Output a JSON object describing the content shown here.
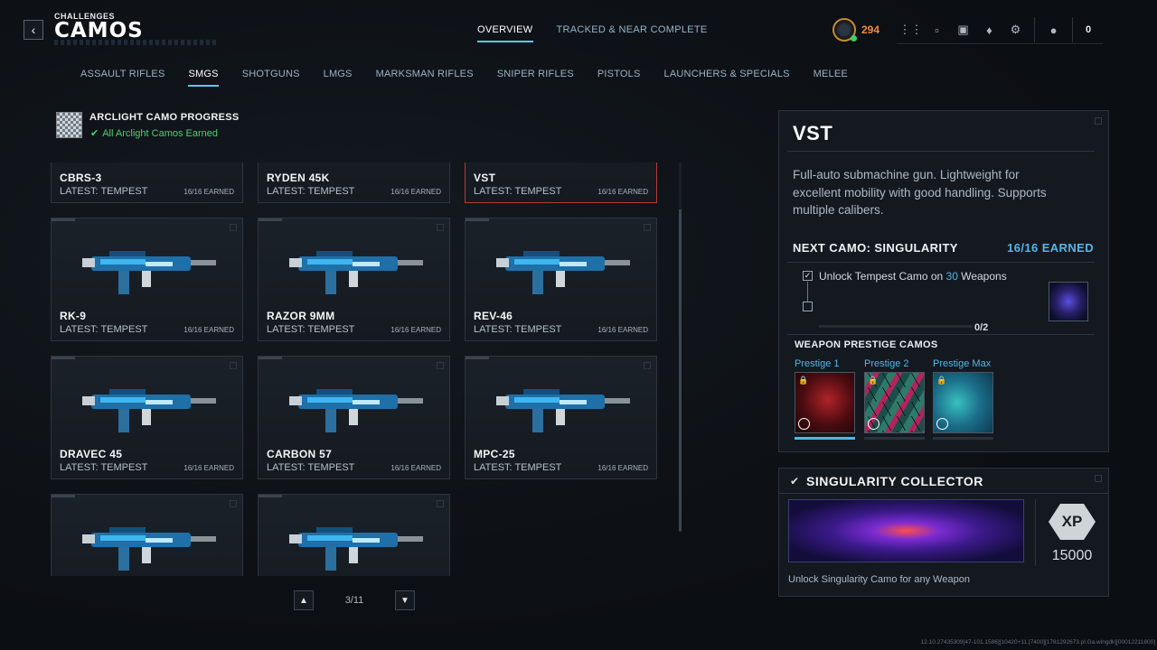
{
  "header": {
    "breadcrumb": "CHALLENGES",
    "title": "CAMOS",
    "top_tabs": [
      {
        "label": "OVERVIEW",
        "active": true
      },
      {
        "label": "TRACKED & NEAR COMPLETE",
        "active": false
      }
    ],
    "rank_value": "294",
    "player_count": "0",
    "hud_icons": [
      "apps-grid-icon",
      "unlock-icon",
      "camera-icon",
      "bell-icon",
      "gear-icon",
      "party-icon"
    ]
  },
  "category_tabs": [
    {
      "label": "ASSAULT RIFLES",
      "active": false
    },
    {
      "label": "SMGS",
      "active": true
    },
    {
      "label": "SHOTGUNS",
      "active": false
    },
    {
      "label": "LMGS",
      "active": false
    },
    {
      "label": "MARKSMAN RIFLES",
      "active": false
    },
    {
      "label": "SNIPER RIFLES",
      "active": false
    },
    {
      "label": "PISTOLS",
      "active": false
    },
    {
      "label": "LAUNCHERS & SPECIALS",
      "active": false
    },
    {
      "label": "MELEE",
      "active": false
    }
  ],
  "arclight": {
    "title": "ARCLIGHT CAMO PROGRESS",
    "status": "All Arclight Camos Earned",
    "status_color": "#48d36f"
  },
  "weapons": [
    {
      "name": "CBRS-3",
      "latest": "LATEST: TEMPEST",
      "earned": "16/16 EARNED",
      "selected": false
    },
    {
      "name": "RYDEN 45K",
      "latest": "LATEST: TEMPEST",
      "earned": "16/16 EARNED",
      "selected": false
    },
    {
      "name": "VST",
      "latest": "LATEST: TEMPEST",
      "earned": "16/16 EARNED",
      "selected": true
    },
    {
      "name": "RK-9",
      "latest": "LATEST: TEMPEST",
      "earned": "16/16 EARNED",
      "selected": false
    },
    {
      "name": "RAZOR 9MM",
      "latest": "LATEST: TEMPEST",
      "earned": "16/16 EARNED",
      "selected": false
    },
    {
      "name": "REV-46",
      "latest": "LATEST: TEMPEST",
      "earned": "16/16 EARNED",
      "selected": false
    },
    {
      "name": "DRAVEC 45",
      "latest": "LATEST: TEMPEST",
      "earned": "16/16 EARNED",
      "selected": false
    },
    {
      "name": "CARBON 57",
      "latest": "LATEST: TEMPEST",
      "earned": "16/16 EARNED",
      "selected": false
    },
    {
      "name": "MPC-25",
      "latest": "LATEST: TEMPEST",
      "earned": "16/16 EARNED",
      "selected": false
    },
    {
      "name": "",
      "latest": "",
      "earned": "",
      "selected": false
    },
    {
      "name": "",
      "latest": "",
      "earned": "",
      "selected": false
    }
  ],
  "pager": {
    "label": "3/11"
  },
  "detail": {
    "weapon_name": "VST",
    "description": "Full-auto submachine gun. Lightweight for excellent mobility with good handling. Supports multiple calibers.",
    "next_camo_label": "NEXT CAMO: SINGULARITY",
    "next_camo_earned": "16/16 EARNED",
    "requirement_prefix": "Unlock Tempest Camo on ",
    "requirement_number": "30",
    "requirement_suffix": " Weapons",
    "requirement_progress": "0/2",
    "prestige_title": "WEAPON PRESTIGE CAMOS",
    "prestige": [
      {
        "label": "Prestige 1",
        "filled": true
      },
      {
        "label": "Prestige 2",
        "filled": false
      },
      {
        "label": "Prestige Max",
        "filled": false
      }
    ]
  },
  "collector": {
    "title": "SINGULARITY COLLECTOR",
    "xp_label": "XP",
    "xp_amount": "15000",
    "description": "Unlock Singularity Camo for any Weapon"
  },
  "build_info": "12.10.27435309[47-101.1586][10420+11.[7400][1781292673.pl.Ga.wingdk][00012211800]",
  "colors": {
    "accent": "#55b6e6",
    "selected_border": "#b83a3a",
    "rank": "#f08a3a"
  }
}
